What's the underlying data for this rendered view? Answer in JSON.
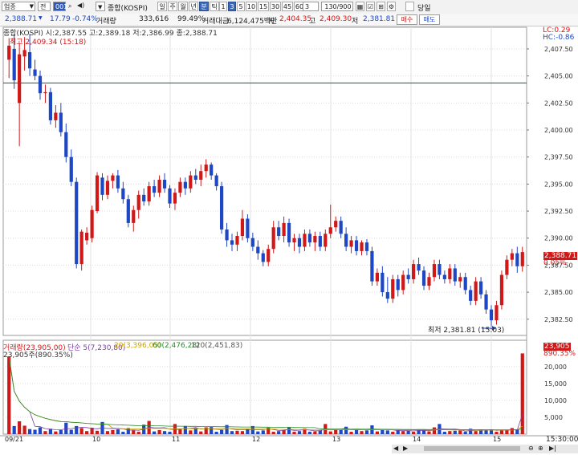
{
  "toolbar": {
    "market_select": "업종",
    "period_select": "전",
    "code_input": "001",
    "index_name": "종합(KOSPI)",
    "period_buttons": [
      "일",
      "주",
      "월",
      "년",
      "분",
      "틱"
    ],
    "active_period": "분",
    "interval_buttons": [
      "1",
      "3",
      "5",
      "10",
      "15",
      "30",
      "45",
      "60"
    ],
    "active_interval": "3",
    "interval_value": "3",
    "count_display": "130/900",
    "today_label": "당일"
  },
  "quote": {
    "price": "2,388.71",
    "change": "17.79",
    "change_pct": "-0.74%",
    "volume_label": "거래량",
    "volume": "333,616",
    "ratio": "99.49%",
    "amount_label": "거래대금",
    "amount": "6,124,475백만",
    "open_label": "시",
    "open": "2,404.35",
    "high_label": "고",
    "high": "2,409.30",
    "low_label": "저",
    "low": "2,381.81",
    "buy_button": "매수",
    "sell_button": "매도"
  },
  "legend": {
    "price_series": "종합(KOSPI) 시:2,387.55 고:2,389.18 저:2,386.99 종:2,388.71",
    "high_annotation": "최고 2,409.34 (15:18)",
    "low_annotation": "최저 2,381.81 (15:03)",
    "lc": "LC:0.29",
    "hc": "HC:-0.86",
    "last_price_tag": "2,388.71",
    "last_pct_tag": "0.05%",
    "volume_series": "거래량(23,905,00)",
    "ma5": "단순 5(7,230,80)",
    "ma20": "20(3,396,05)",
    "ma60": "60(2,476,28)",
    "ma120": "120(2,451,83)",
    "volume_sub": "23,905주(890.35%)",
    "vol_tag": "23,905",
    "vol_pct_tag": "890.35%",
    "time_label": "15:30:00"
  },
  "chart_data": {
    "type": "candlestick",
    "x_ticks": [
      "09/21",
      "10",
      "11",
      "12",
      "13",
      "14",
      "15"
    ],
    "y_ticks": [
      2382.5,
      2385.0,
      2387.5,
      2390.0,
      2392.5,
      2395.0,
      2397.5,
      2400.0,
      2402.5,
      2405.0,
      2407.5
    ],
    "y_range": [
      2381.0,
      2409.5
    ],
    "reference_line": 2404.35,
    "volume_ticks": [
      5000,
      10000,
      15000,
      20000
    ],
    "volume_range": [
      0,
      24000
    ],
    "candles": [
      {
        "o": 2406.5,
        "h": 2408.5,
        "l": 2404.8,
        "c": 2407.8
      },
      {
        "o": 2407.5,
        "h": 2408.8,
        "l": 2403.8,
        "c": 2404.6
      },
      {
        "o": 2402.5,
        "h": 2408.0,
        "l": 2398.5,
        "c": 2407.0
      },
      {
        "o": 2406.8,
        "h": 2408.6,
        "l": 2405.5,
        "c": 2407.4
      },
      {
        "o": 2407.2,
        "h": 2408.9,
        "l": 2405.0,
        "c": 2405.7
      },
      {
        "o": 2405.6,
        "h": 2406.5,
        "l": 2404.6,
        "c": 2405.0
      },
      {
        "o": 2405.0,
        "h": 2405.5,
        "l": 2402.8,
        "c": 2403.4
      },
      {
        "o": 2403.4,
        "h": 2404.2,
        "l": 2402.5,
        "c": 2403.5
      },
      {
        "o": 2403.5,
        "h": 2403.9,
        "l": 2400.5,
        "c": 2400.9
      },
      {
        "o": 2400.9,
        "h": 2402.3,
        "l": 2400.2,
        "c": 2401.6
      },
      {
        "o": 2401.6,
        "h": 2402.5,
        "l": 2399.4,
        "c": 2399.8
      },
      {
        "o": 2399.8,
        "h": 2400.6,
        "l": 2397.0,
        "c": 2397.5
      },
      {
        "o": 2397.5,
        "h": 2398.2,
        "l": 2394.8,
        "c": 2395.2
      },
      {
        "o": 2395.2,
        "h": 2395.6,
        "l": 2387.2,
        "c": 2387.6
      },
      {
        "o": 2387.6,
        "h": 2390.8,
        "l": 2387.0,
        "c": 2390.6
      },
      {
        "o": 2389.8,
        "h": 2391.0,
        "l": 2389.4,
        "c": 2390.5
      },
      {
        "o": 2390.0,
        "h": 2393.0,
        "l": 2389.6,
        "c": 2392.6
      },
      {
        "o": 2392.5,
        "h": 2396.1,
        "l": 2392.3,
        "c": 2395.8
      },
      {
        "o": 2395.6,
        "h": 2396.0,
        "l": 2393.5,
        "c": 2394.0
      },
      {
        "o": 2394.0,
        "h": 2395.8,
        "l": 2393.6,
        "c": 2395.3
      },
      {
        "o": 2395.3,
        "h": 2396.0,
        "l": 2394.6,
        "c": 2395.8
      },
      {
        "o": 2395.8,
        "h": 2396.3,
        "l": 2394.2,
        "c": 2394.6
      },
      {
        "o": 2394.6,
        "h": 2395.2,
        "l": 2393.2,
        "c": 2393.6
      },
      {
        "o": 2393.6,
        "h": 2394.0,
        "l": 2391.0,
        "c": 2391.4
      },
      {
        "o": 2391.4,
        "h": 2393.0,
        "l": 2390.6,
        "c": 2392.6
      },
      {
        "o": 2392.6,
        "h": 2394.4,
        "l": 2391.8,
        "c": 2394.0
      },
      {
        "o": 2394.0,
        "h": 2394.6,
        "l": 2393.0,
        "c": 2393.4
      },
      {
        "o": 2393.4,
        "h": 2395.2,
        "l": 2393.0,
        "c": 2394.8
      },
      {
        "o": 2394.8,
        "h": 2395.4,
        "l": 2393.8,
        "c": 2394.2
      },
      {
        "o": 2394.2,
        "h": 2395.8,
        "l": 2393.8,
        "c": 2395.4
      },
      {
        "o": 2395.4,
        "h": 2396.0,
        "l": 2394.2,
        "c": 2394.6
      },
      {
        "o": 2394.6,
        "h": 2394.9,
        "l": 2392.8,
        "c": 2393.2
      },
      {
        "o": 2393.2,
        "h": 2394.6,
        "l": 2392.6,
        "c": 2394.2
      },
      {
        "o": 2394.2,
        "h": 2395.6,
        "l": 2393.8,
        "c": 2395.2
      },
      {
        "o": 2395.2,
        "h": 2395.6,
        "l": 2394.0,
        "c": 2394.6
      },
      {
        "o": 2394.6,
        "h": 2396.2,
        "l": 2394.2,
        "c": 2395.8
      },
      {
        "o": 2395.8,
        "h": 2396.4,
        "l": 2395.0,
        "c": 2395.4
      },
      {
        "o": 2395.4,
        "h": 2396.8,
        "l": 2394.8,
        "c": 2396.2
      },
      {
        "o": 2396.2,
        "h": 2397.3,
        "l": 2395.6,
        "c": 2396.8
      },
      {
        "o": 2396.8,
        "h": 2397.0,
        "l": 2395.4,
        "c": 2395.8
      },
      {
        "o": 2395.8,
        "h": 2396.0,
        "l": 2394.4,
        "c": 2394.8
      },
      {
        "o": 2394.8,
        "h": 2395.2,
        "l": 2390.4,
        "c": 2390.8
      },
      {
        "o": 2390.8,
        "h": 2391.4,
        "l": 2389.2,
        "c": 2389.8
      },
      {
        "o": 2389.8,
        "h": 2390.4,
        "l": 2388.8,
        "c": 2389.4
      },
      {
        "o": 2389.4,
        "h": 2390.6,
        "l": 2388.8,
        "c": 2390.2
      },
      {
        "o": 2390.2,
        "h": 2392.6,
        "l": 2389.8,
        "c": 2391.8
      },
      {
        "o": 2391.8,
        "h": 2392.2,
        "l": 2389.6,
        "c": 2390.0
      },
      {
        "o": 2390.0,
        "h": 2390.5,
        "l": 2388.8,
        "c": 2389.2
      },
      {
        "o": 2389.2,
        "h": 2389.8,
        "l": 2388.0,
        "c": 2388.6
      },
      {
        "o": 2388.6,
        "h": 2388.9,
        "l": 2387.4,
        "c": 2387.8
      },
      {
        "o": 2387.8,
        "h": 2389.4,
        "l": 2387.4,
        "c": 2389.0
      },
      {
        "o": 2389.0,
        "h": 2391.6,
        "l": 2388.6,
        "c": 2391.0
      },
      {
        "o": 2391.0,
        "h": 2391.6,
        "l": 2389.8,
        "c": 2390.2
      },
      {
        "o": 2390.2,
        "h": 2392.0,
        "l": 2389.6,
        "c": 2391.4
      },
      {
        "o": 2391.4,
        "h": 2391.8,
        "l": 2389.2,
        "c": 2389.6
      },
      {
        "o": 2389.6,
        "h": 2390.4,
        "l": 2388.8,
        "c": 2390.0
      },
      {
        "o": 2390.0,
        "h": 2390.4,
        "l": 2388.6,
        "c": 2389.2
      },
      {
        "o": 2389.2,
        "h": 2390.8,
        "l": 2388.8,
        "c": 2390.4
      },
      {
        "o": 2390.4,
        "h": 2390.8,
        "l": 2389.2,
        "c": 2389.6
      },
      {
        "o": 2389.6,
        "h": 2390.6,
        "l": 2388.8,
        "c": 2390.2
      },
      {
        "o": 2390.2,
        "h": 2390.6,
        "l": 2388.8,
        "c": 2389.2
      },
      {
        "o": 2389.2,
        "h": 2390.8,
        "l": 2388.8,
        "c": 2390.4
      },
      {
        "o": 2390.4,
        "h": 2393.1,
        "l": 2390.0,
        "c": 2391.0
      },
      {
        "o": 2391.0,
        "h": 2392.0,
        "l": 2390.6,
        "c": 2391.6
      },
      {
        "o": 2391.6,
        "h": 2392.0,
        "l": 2390.0,
        "c": 2390.4
      },
      {
        "o": 2390.4,
        "h": 2391.0,
        "l": 2388.8,
        "c": 2389.2
      },
      {
        "o": 2389.2,
        "h": 2390.2,
        "l": 2388.6,
        "c": 2389.8
      },
      {
        "o": 2389.8,
        "h": 2390.2,
        "l": 2388.4,
        "c": 2388.8
      },
      {
        "o": 2388.8,
        "h": 2389.8,
        "l": 2388.4,
        "c": 2389.6
      },
      {
        "o": 2389.6,
        "h": 2389.9,
        "l": 2388.4,
        "c": 2388.8
      },
      {
        "o": 2388.8,
        "h": 2389.2,
        "l": 2385.6,
        "c": 2386.0
      },
      {
        "o": 2386.0,
        "h": 2387.2,
        "l": 2385.6,
        "c": 2386.8
      },
      {
        "o": 2386.8,
        "h": 2387.4,
        "l": 2384.6,
        "c": 2385.0
      },
      {
        "o": 2385.0,
        "h": 2386.4,
        "l": 2384.0,
        "c": 2384.4
      },
      {
        "o": 2384.4,
        "h": 2386.6,
        "l": 2384.0,
        "c": 2386.2
      },
      {
        "o": 2386.2,
        "h": 2386.6,
        "l": 2384.6,
        "c": 2385.2
      },
      {
        "o": 2385.2,
        "h": 2387.0,
        "l": 2384.8,
        "c": 2386.6
      },
      {
        "o": 2386.6,
        "h": 2387.2,
        "l": 2385.8,
        "c": 2386.2
      },
      {
        "o": 2386.2,
        "h": 2388.0,
        "l": 2385.8,
        "c": 2387.6
      },
      {
        "o": 2387.6,
        "h": 2388.2,
        "l": 2386.6,
        "c": 2387.0
      },
      {
        "o": 2387.0,
        "h": 2387.4,
        "l": 2385.2,
        "c": 2385.6
      },
      {
        "o": 2385.6,
        "h": 2386.8,
        "l": 2385.2,
        "c": 2386.4
      },
      {
        "o": 2386.4,
        "h": 2388.0,
        "l": 2386.0,
        "c": 2387.6
      },
      {
        "o": 2387.6,
        "h": 2388.0,
        "l": 2386.2,
        "c": 2386.6
      },
      {
        "o": 2386.6,
        "h": 2387.0,
        "l": 2385.8,
        "c": 2386.2
      },
      {
        "o": 2386.2,
        "h": 2387.6,
        "l": 2385.8,
        "c": 2387.2
      },
      {
        "o": 2387.2,
        "h": 2387.6,
        "l": 2385.6,
        "c": 2386.0
      },
      {
        "o": 2386.0,
        "h": 2386.8,
        "l": 2385.4,
        "c": 2386.4
      },
      {
        "o": 2386.4,
        "h": 2386.8,
        "l": 2384.8,
        "c": 2385.2
      },
      {
        "o": 2385.2,
        "h": 2385.6,
        "l": 2383.8,
        "c": 2384.2
      },
      {
        "o": 2384.2,
        "h": 2386.4,
        "l": 2383.8,
        "c": 2386.0
      },
      {
        "o": 2386.0,
        "h": 2386.4,
        "l": 2384.4,
        "c": 2384.8
      },
      {
        "o": 2384.8,
        "h": 2385.2,
        "l": 2383.0,
        "c": 2383.4
      },
      {
        "o": 2383.4,
        "h": 2383.8,
        "l": 2381.8,
        "c": 2382.4
      },
      {
        "o": 2382.4,
        "h": 2384.2,
        "l": 2382.0,
        "c": 2383.8
      },
      {
        "o": 2383.8,
        "h": 2387.0,
        "l": 2383.4,
        "c": 2386.6
      },
      {
        "o": 2386.6,
        "h": 2388.4,
        "l": 2386.2,
        "c": 2388.0
      },
      {
        "o": 2388.0,
        "h": 2389.0,
        "l": 2387.4,
        "c": 2388.6
      },
      {
        "o": 2388.6,
        "h": 2389.2,
        "l": 2386.8,
        "c": 2387.4
      },
      {
        "o": 2387.4,
        "h": 2389.2,
        "l": 2386.9,
        "c": 2388.71
      }
    ],
    "volumes": [
      23000,
      2400,
      3800,
      2500,
      1500,
      1300,
      2000,
      900,
      1600,
      800,
      1200,
      3400,
      1300,
      2400,
      1800,
      900,
      1900,
      1000,
      3600,
      900,
      1200,
      1400,
      700,
      1800,
      1100,
      700,
      2800,
      3900,
      800,
      1200,
      900,
      700,
      3000,
      1400,
      2400,
      1100,
      1800,
      800,
      2000,
      2100,
      700,
      1200,
      2700,
      900,
      1000,
      900,
      1600,
      2400,
      800,
      1100,
      1900,
      700,
      900,
      1200,
      2100,
      700,
      900,
      1600,
      700,
      800,
      1100,
      3000,
      800,
      1400,
      1300,
      2200,
      700,
      1400,
      900,
      1100,
      2600,
      800,
      1200,
      1100,
      700,
      1300,
      900,
      1100,
      700,
      1300,
      1200,
      800,
      2000,
      3000,
      700,
      900,
      1000,
      1100,
      700,
      1600,
      900,
      1400,
      1200,
      1400,
      700,
      1300,
      1100,
      1800,
      1400,
      23905
    ]
  }
}
